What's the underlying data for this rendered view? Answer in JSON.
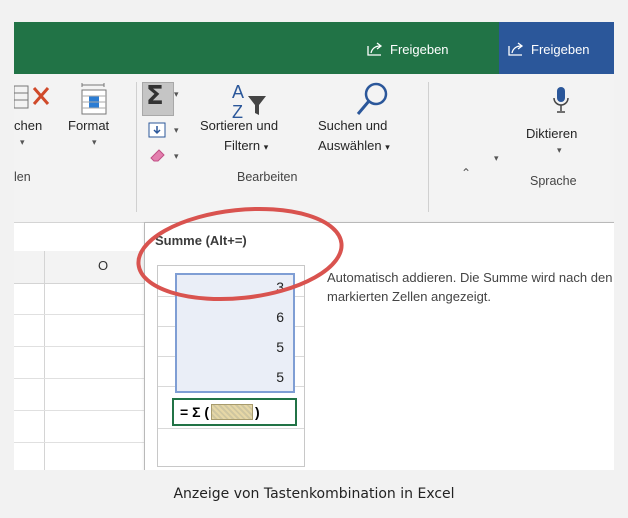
{
  "titlebar": {
    "share_left": "Freigeben",
    "share_right": "Freigeben",
    "color_excel": "#217346",
    "color_word": "#2b579a"
  },
  "ribbon": {
    "partial_label": "chen",
    "format_label": "Format",
    "partial_group": "len",
    "sort_label_1": "Sortieren und",
    "sort_label_2": "Filtern",
    "find_label_1": "Suchen und",
    "find_label_2": "Auswählen",
    "group_edit": "Bearbeiten",
    "dictate_label": "Diktieren",
    "group_voice": "Sprache"
  },
  "sheet": {
    "column_header": "O"
  },
  "tooltip": {
    "title": "Summe (Alt+=)",
    "description": "Automatisch addieren. Die Summe wird nach den markierten Zellen angezeigt.",
    "values": [
      "3",
      "6",
      "5",
      "5"
    ],
    "formula_prefix": "= Σ (",
    "formula_suffix": ")"
  },
  "caption": "Anzeige von Tastenkombination in Excel"
}
